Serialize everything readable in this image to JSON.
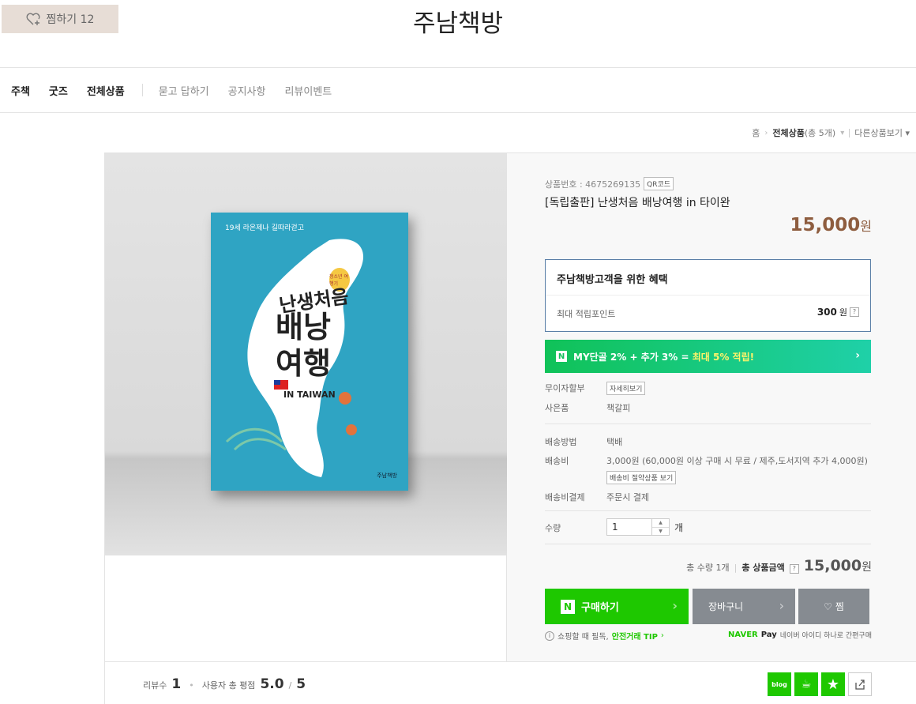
{
  "header": {
    "wish_label": "찜하기 12",
    "store_title": "주남책방"
  },
  "nav": {
    "main": [
      "주책",
      "굿즈",
      "전체상품"
    ],
    "sub": [
      "묻고 답하기",
      "공지사항",
      "리뷰이벤트"
    ]
  },
  "breadcrumb": {
    "home": "홈",
    "current": "전체상품",
    "count": "(총 5개)",
    "other": "다른상품보기"
  },
  "product": {
    "number_label": "상품번호 : 4675269135",
    "qr_label": "QR코드",
    "name": "[독립출판] 난생처음 배낭여행 in 타이완",
    "price": "15,000",
    "price_unit": "원",
    "image_text": {
      "sub": "19세 라온제나 길따라걷고",
      "title": "난생처음",
      "big1": "배낭",
      "big2": "여행",
      "taiwan": "IN TAIWAN",
      "badge": "청소년 여행기",
      "publisher": "주남책방"
    }
  },
  "benefit": {
    "title": "주남책방고객을 위한 혜택",
    "label": "최대 적립포인트",
    "value": "300",
    "unit": "원",
    "help": "?"
  },
  "npay_banner": {
    "logo": "N",
    "text": "MY단골 2% + 추가 3% = ",
    "highlight": "최대 5% 적립!",
    "chevron": "›"
  },
  "details": {
    "installment_label": "무이자할부",
    "installment_btn": "자세히보기",
    "gift_label": "사은품",
    "gift_value": "책갈피",
    "ship_method_label": "배송방법",
    "ship_method_value": "택배",
    "ship_fee_label": "배송비",
    "ship_fee_value": "3,000원 (60,000원 이상 구매 시 무료 / 제주,도서지역 추가 4,000원)",
    "ship_fee_btn": "배송비 절약상품 보기",
    "ship_pay_label": "배송비결제",
    "ship_pay_value": "주문시 결제",
    "qty_label": "수량",
    "qty_value": "1",
    "qty_unit": "개"
  },
  "total": {
    "count": "총 수량 1개",
    "label": "총 상품금액",
    "help": "?",
    "amount": "15,000",
    "unit": "원"
  },
  "buttons": {
    "buy_logo": "N",
    "buy": "구매하기",
    "cart": "장바구니",
    "zzim": "찜"
  },
  "notes": {
    "safe_prefix": "쇼핑할 때 필독,",
    "safe_link": "안전거래 TIP",
    "npay_logo": "NAVER",
    "npay_pay": "Pay",
    "npay_text": "네이버 아이디 하나로 간편구매"
  },
  "reviews": {
    "count_label": "리뷰수",
    "count": "1",
    "rating_label": "사용자 총 평점",
    "rating": "5.0",
    "max": "5"
  },
  "share": {
    "blog": "blog"
  },
  "colors": {
    "naver_green": "#1ec800",
    "price_brown": "#8e5d3f",
    "gray_button": "#868b91",
    "book_blue": "#2fa4c3"
  }
}
